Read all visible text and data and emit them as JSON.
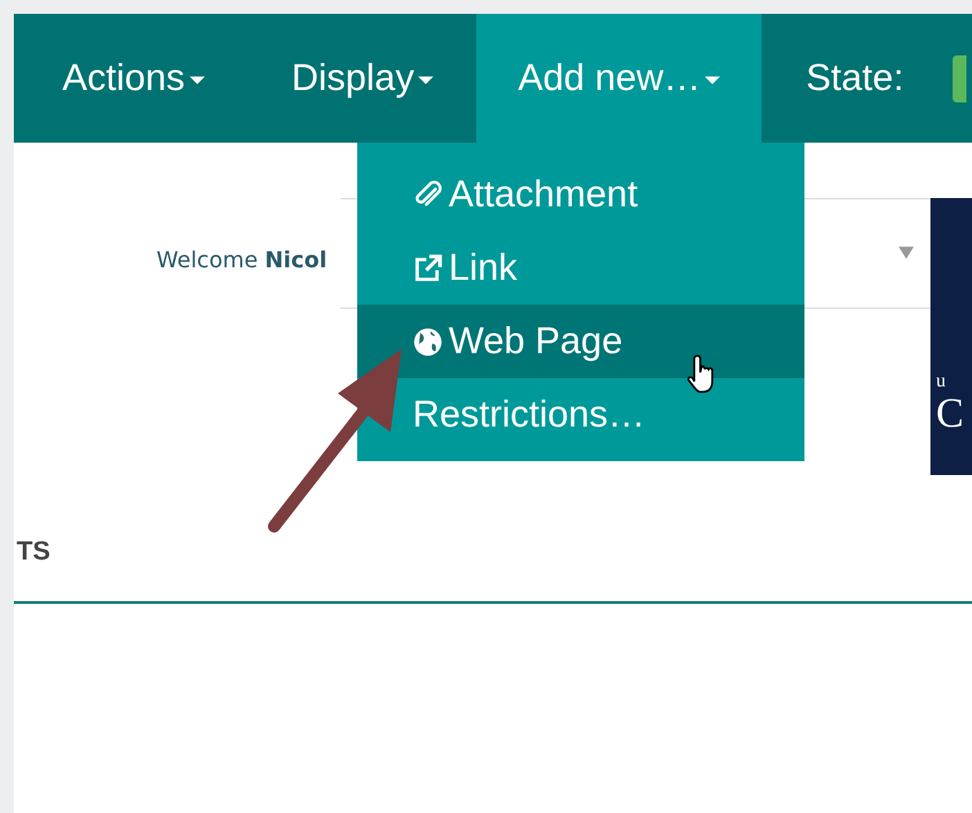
{
  "nav": {
    "items": [
      {
        "label": "Actions",
        "has_menu": true,
        "selected": false
      },
      {
        "label": "Display",
        "has_menu": true,
        "selected": false
      },
      {
        "label": "Add new…",
        "has_menu": true,
        "selected": true
      },
      {
        "label": "State:",
        "has_menu": false,
        "selected": false
      }
    ]
  },
  "menu": {
    "items": [
      {
        "label": "Attachment",
        "kind": "attachment",
        "selected": false
      },
      {
        "label": "Link",
        "kind": "link",
        "selected": false
      },
      {
        "label": "Web Page",
        "kind": "webpage",
        "selected": true
      },
      {
        "label": "Restrictions…",
        "kind": "plain",
        "selected": false
      }
    ]
  },
  "welcome": "Welcome **Nicol**",
  "banner": {
    "line_1": "u",
    "line_2": "C"
  },
  "section_heading": "TS"
}
